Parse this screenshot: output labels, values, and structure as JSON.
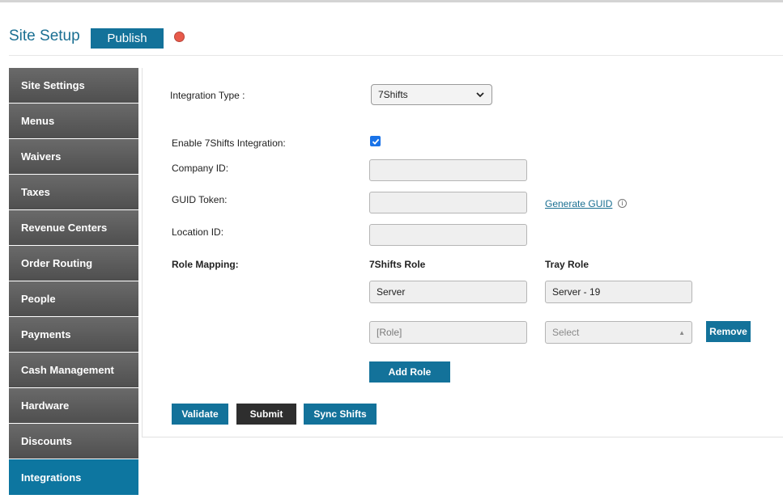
{
  "header": {
    "title": "Site Setup",
    "publish_label": "Publish",
    "status_color": "#e85a4a"
  },
  "sidebar": {
    "items": [
      {
        "label": "Site Settings"
      },
      {
        "label": "Menus"
      },
      {
        "label": "Waivers"
      },
      {
        "label": "Taxes"
      },
      {
        "label": "Revenue Centers"
      },
      {
        "label": "Order Routing"
      },
      {
        "label": "People"
      },
      {
        "label": "Payments"
      },
      {
        "label": "Cash Management"
      },
      {
        "label": "Hardware"
      },
      {
        "label": "Discounts"
      },
      {
        "label": "Integrations"
      }
    ],
    "active_index": 11,
    "active_color": "#0d76a0"
  },
  "form": {
    "integration_type_label": "Integration Type :",
    "integration_type_value": "7Shifts",
    "enable_label": "Enable 7Shifts Integration:",
    "enable_checked": true,
    "company_id_label": "Company ID:",
    "company_id_value": "",
    "guid_token_label": "GUID Token:",
    "guid_token_value": "",
    "generate_guid_label": "Generate GUID",
    "info_glyph": "i",
    "location_id_label": "Location ID:",
    "location_id_value": "",
    "role_mapping_label": "Role Mapping:",
    "col_7shifts_role": "7Shifts Role",
    "col_tray_role": "Tray Role",
    "mappings": [
      {
        "shifts_role": "Server",
        "tray_role": "Server - 19"
      }
    ],
    "new_role_placeholder": "[Role]",
    "new_tray_placeholder": "Select",
    "remove_label": "Remove",
    "add_role_label": "Add Role",
    "validate_label": "Validate",
    "submit_label": "Submit",
    "sync_label": "Sync Shifts"
  },
  "colors": {
    "brand_blue": "#13729a",
    "dark_button": "#2e2e2e",
    "title_blue": "#1a6f92"
  }
}
